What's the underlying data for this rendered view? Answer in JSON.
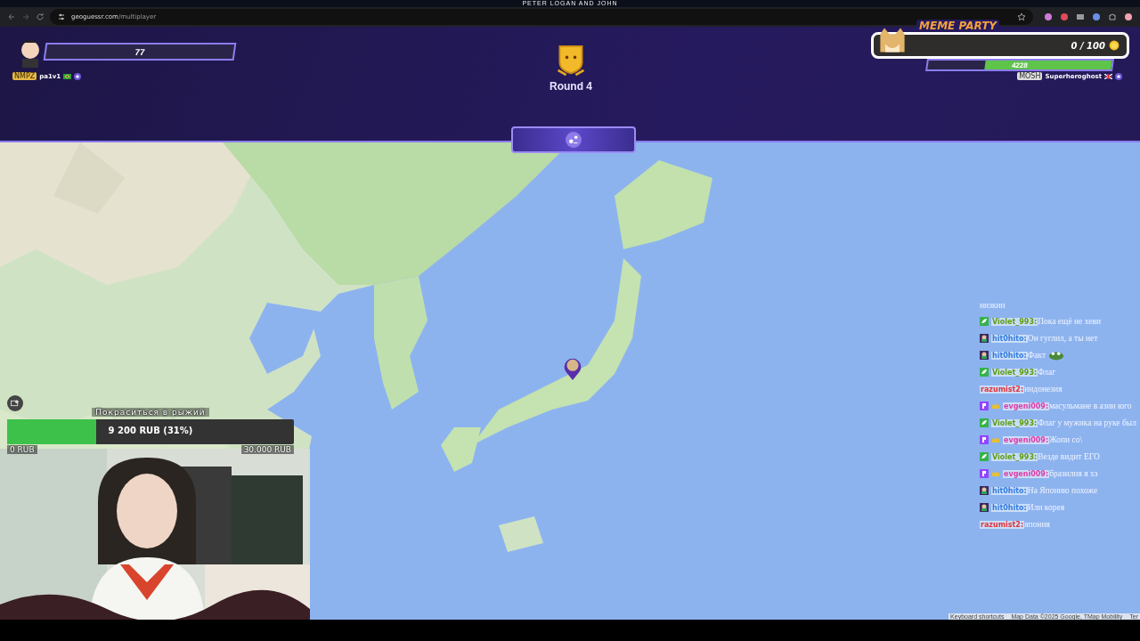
{
  "banner": {
    "text": "PETER LOGAN AND JOHN"
  },
  "browser": {
    "url_host": "geoguessr.com",
    "url_path": "/multiplayer"
  },
  "players": [
    {
      "health": "77",
      "tag": "NMPZ",
      "name": "pa1v1"
    },
    {
      "health": "4228",
      "level": 0.69,
      "tag": "MOSH",
      "name": "Superheroghost"
    }
  ],
  "round": {
    "label": "Round 4"
  },
  "meme_party": {
    "title": "MEME PARTY",
    "count": "0 / 100"
  },
  "donation": {
    "goal": "Покраситься в рыжий",
    "amount": "9 200 RUB (31%)",
    "level": 0.31,
    "min": "0 RUB",
    "max": "30.000 RUB"
  },
  "chat": [
    {
      "kind": "text",
      "text": "низкин"
    },
    {
      "kind": "leaf",
      "user": "Violet_993:",
      "color": "#5c9e12",
      "text": "Пока ещё не хеви"
    },
    {
      "kind": "avatar",
      "user": "hit0hito:",
      "color": "#2f7be0",
      "text": "Он гуглил, а ты нет"
    },
    {
      "kind": "avatar",
      "user": "hit0hito:",
      "color": "#2f7be0",
      "text": "Факт",
      "emote": true
    },
    {
      "kind": "leaf",
      "user": "Violet_993:",
      "color": "#5c9e12",
      "text": "Флаг"
    },
    {
      "kind": "plain",
      "user": "razumist2:",
      "color": "#e0343c",
      "text": "индонезия"
    },
    {
      "kind": "sub",
      "user": "evgeni009:",
      "color": "#e23aa8",
      "text": "масульмане в азии юго"
    },
    {
      "kind": "leaf",
      "user": "Violet_993:",
      "color": "#5c9e12",
      "text": "Флаг у мужика на руке был"
    },
    {
      "kind": "sub",
      "user": "evgeni009:",
      "color": "#e23aa8",
      "text": "Жопи со\\"
    },
    {
      "kind": "leaf",
      "user": "Violet_993:",
      "color": "#5c9e12",
      "text": "Везде видит ЕГО"
    },
    {
      "kind": "sub",
      "user": "evgeni009:",
      "color": "#e23aa8",
      "text": "бразилия я хз"
    },
    {
      "kind": "avatar",
      "user": "hit0hito:",
      "color": "#2f7be0",
      "text": "На Японию похоже"
    },
    {
      "kind": "avatar",
      "user": "hit0hito:",
      "color": "#2f7be0",
      "text": "Или корея"
    },
    {
      "kind": "plain",
      "user": "razumist2:",
      "color": "#e0343c",
      "text": "япония"
    }
  ],
  "map_footer": [
    "Keyboard shortcuts",
    "Map Data ©2025 Google, TMap Mobility",
    "Ter"
  ]
}
